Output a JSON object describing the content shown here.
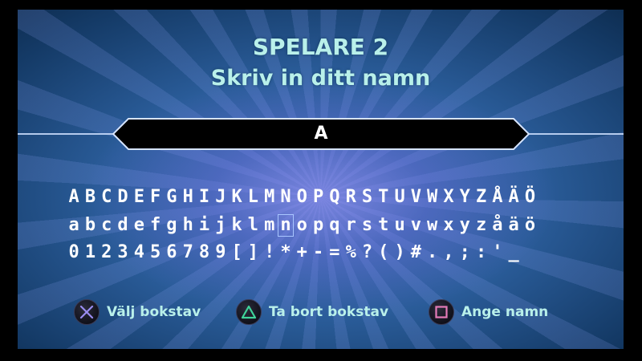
{
  "header": {
    "player": "SPELARE 2",
    "prompt": "Skriv in ditt namn"
  },
  "name_entry": {
    "value": "A"
  },
  "keyboard": {
    "rows": [
      [
        "A",
        "B",
        "C",
        "D",
        "E",
        "F",
        "G",
        "H",
        "I",
        "J",
        "K",
        "L",
        "M",
        "N",
        "O",
        "P",
        "Q",
        "R",
        "S",
        "T",
        "U",
        "V",
        "W",
        "X",
        "Y",
        "Z",
        "Å",
        "Ä",
        "Ö"
      ],
      [
        "a",
        "b",
        "c",
        "d",
        "e",
        "f",
        "g",
        "h",
        "i",
        "j",
        "k",
        "l",
        "m",
        "n",
        "o",
        "p",
        "q",
        "r",
        "s",
        "t",
        "u",
        "v",
        "w",
        "x",
        "y",
        "z",
        "å",
        "ä",
        "ö"
      ],
      [
        "0",
        "1",
        "2",
        "3",
        "4",
        "5",
        "6",
        "7",
        "8",
        "9",
        "[",
        "]",
        "!",
        "*",
        "+",
        "-",
        "=",
        "%",
        "?",
        "(",
        ")",
        "#",
        ".",
        ",",
        ";",
        ":",
        "'",
        "_"
      ]
    ],
    "selected": "n"
  },
  "controls": {
    "select_label": "Välj bokstav",
    "delete_label": "Ta bort bokstav",
    "confirm_label": "Ange namn"
  },
  "colors": {
    "cross": "#9a8cf0",
    "triangle": "#3fd39a",
    "square": "#e47bb8",
    "text_accent": "#b9f0ea"
  }
}
